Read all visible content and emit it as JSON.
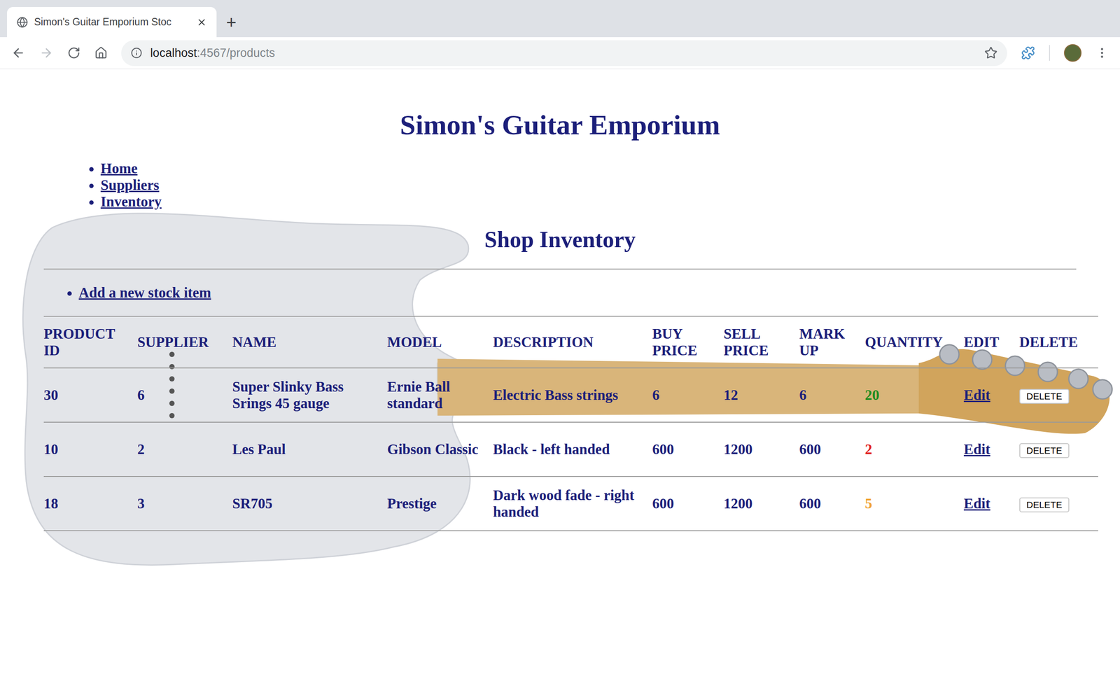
{
  "window": {
    "title": "Simon's Guitar Emporium Stoc",
    "new_tab": "+"
  },
  "address_bar": {
    "host": "localhost",
    "path": ":4567/products"
  },
  "page": {
    "title": "Simon's Guitar Emporium",
    "nav": [
      {
        "label": "Home"
      },
      {
        "label": "Suppliers"
      },
      {
        "label": "Inventory"
      }
    ],
    "heading": "Shop Inventory",
    "actions": [
      {
        "label": "Add a new stock item"
      }
    ]
  },
  "table": {
    "columns": [
      "PRODUCT ID",
      "SUPPLIER",
      "NAME",
      "MODEL",
      "DESCRIPTION",
      "BUY PRICE",
      "SELL PRICE",
      "MARK UP",
      "QUANTITY",
      "EDIT",
      "DELETE"
    ],
    "rows": [
      {
        "id": "30",
        "supplier": "6",
        "name": "Super Slinky Bass Srings 45 gauge",
        "model": "Ernie Ball standard",
        "description": "Electric Bass strings",
        "buy": "6",
        "sell": "12",
        "markup": "6",
        "quantity": "20",
        "color": "#1e8c1e",
        "edit": "Edit",
        "delete": "DELETE"
      },
      {
        "id": "10",
        "supplier": "2",
        "name": "Les Paul",
        "model": "Gibson Classic",
        "description": "Black - left handed",
        "buy": "600",
        "sell": "1200",
        "markup": "600",
        "quantity": "2",
        "color": "#e0201f",
        "edit": "Edit",
        "delete": "DELETE"
      },
      {
        "id": "18",
        "supplier": "3",
        "name": "SR705",
        "model": "Prestige",
        "description": "Dark wood fade - right handed",
        "buy": "600",
        "sell": "1200",
        "markup": "600",
        "quantity": "5",
        "color": "#f0a030",
        "edit": "Edit",
        "delete": "DELETE"
      }
    ]
  }
}
